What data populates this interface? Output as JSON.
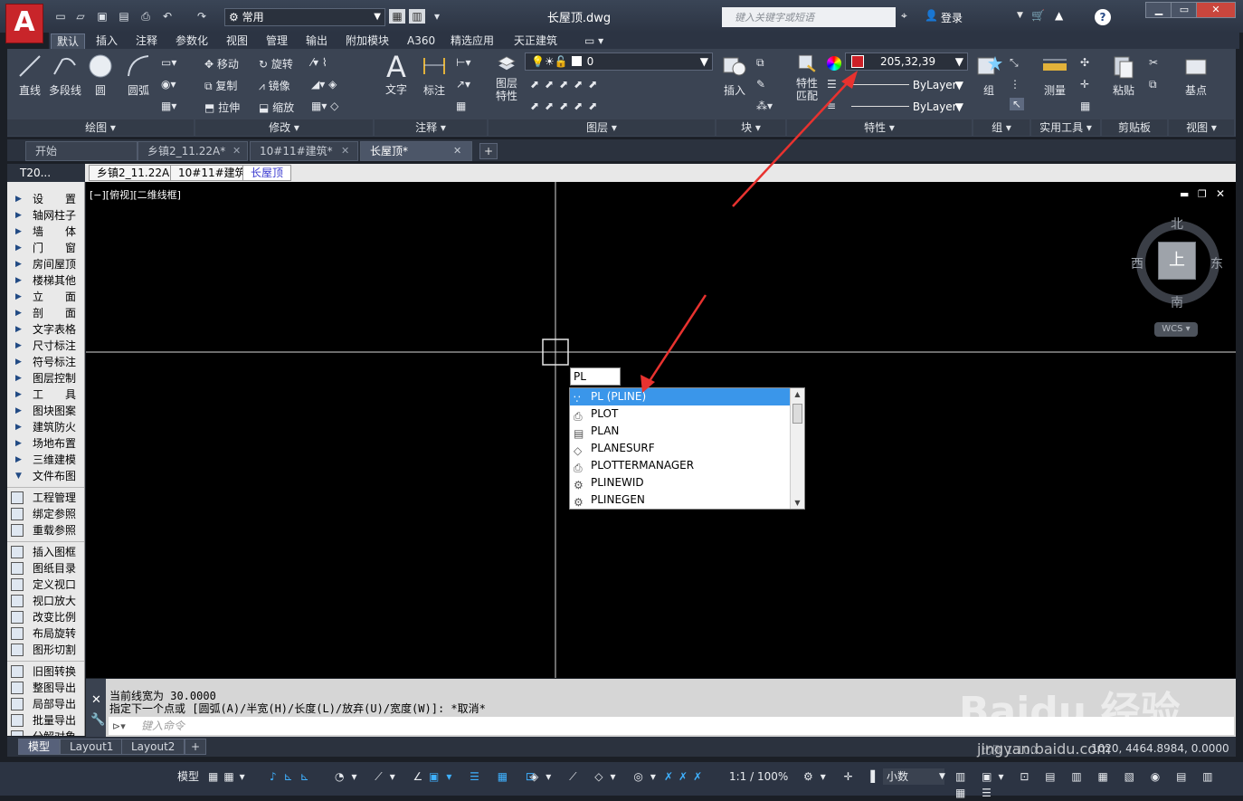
{
  "app": {
    "logo_letter": "A",
    "doc_title": "长屋顶.dwg",
    "workspace": "常用",
    "search_placeholder": "键入关键字或短语",
    "login": "登录",
    "help": "?"
  },
  "ribbon_tabs": [
    "默认",
    "插入",
    "注释",
    "参数化",
    "视图",
    "管理",
    "输出",
    "附加模块",
    "A360",
    "精选应用",
    "天正建筑",
    "▭ ▾"
  ],
  "ribbon": {
    "draw": {
      "title": "绘图 ▾",
      "items": [
        "直线",
        "多段线",
        "圆",
        "圆弧"
      ]
    },
    "modify": {
      "title": "修改 ▾",
      "items": [
        "移动",
        "旋转",
        "复制",
        "镜像",
        "拉伸",
        "缩放"
      ]
    },
    "annot": {
      "title": "注释 ▾",
      "items": [
        "文字",
        "标注"
      ]
    },
    "layers": {
      "title": "图层 ▾",
      "layer_props": "图层\n特性",
      "layer_value": "0"
    },
    "block": {
      "title": "块 ▾",
      "insert": "插入"
    },
    "props": {
      "title": "特性 ▾",
      "match": "特性\n匹配",
      "color": "205,32,39",
      "color_hex": "#cd2027",
      "linetype": "ByLayer",
      "lineweight": "ByLayer"
    },
    "groups": {
      "title": "组 ▾",
      "group": "组"
    },
    "utils": {
      "title": "实用工具 ▾",
      "measure": "测量"
    },
    "clip": {
      "title": "剪贴板",
      "paste": "粘贴"
    },
    "view": {
      "title": "视图 ▾",
      "base": "基点"
    }
  },
  "doc_tabs": [
    "开始",
    "乡镇2_11.22A*",
    "10#11#建筑*",
    "长屋顶*"
  ],
  "file_tabs": [
    "T20...",
    "乡镇2_11.22A",
    "10#11#建筑",
    "长屋顶"
  ],
  "left_menu": {
    "group1": [
      "设　　置",
      "轴网柱子",
      "墙　　体",
      "门　　窗",
      "房间屋顶",
      "楼梯其他",
      "立　　面",
      "剖　　面",
      "文字表格",
      "尺寸标注",
      "符号标注",
      "图层控制",
      "工　　具",
      "图块图案",
      "建筑防火",
      "场地布置",
      "三维建模",
      "文件布图"
    ],
    "group2": [
      "工程管理",
      "绑定参照",
      "重载参照"
    ],
    "group3": [
      "插入图框",
      "图纸目录",
      "定义视口",
      "视口放大",
      "改变比例",
      "布局旋转",
      "图形切割"
    ],
    "group4": [
      "旧图转换",
      "整图导出",
      "局部导出",
      "批量导出",
      "分解对象"
    ]
  },
  "viewport": {
    "label": "[−][俯视][二维线框]",
    "compass": {
      "n": "北",
      "s": "南",
      "e": "东",
      "w": "西",
      "center": "上"
    },
    "wcs": "WCS ▾"
  },
  "autocomplete": {
    "typed": "PL",
    "items": [
      "PL (PLINE)",
      "PLOT",
      "PLAN",
      "PLANESURF",
      "PLOTTERMANAGER",
      "PLINEWID",
      "PLINEGEN"
    ],
    "selected_index": 0
  },
  "command": {
    "history": [
      "当前线宽为 30.0000",
      "指定下一个点或 [圆弧(A)/半宽(H)/长度(L)/放弃(U)/宽度(W)]: *取消*"
    ],
    "placeholder": "键入命令"
  },
  "layout_tabs": [
    "模型",
    "Layout1",
    "Layout2",
    "+"
  ],
  "status": {
    "scale": "比例 1:100",
    "coords": "1020, 4464.8984, 0.0000",
    "model": "模型",
    "zoom": "1:1 / 100%",
    "units": "小数"
  },
  "watermark": "Baidu 经验",
  "watermark_url": "jingyan.baidu.com"
}
